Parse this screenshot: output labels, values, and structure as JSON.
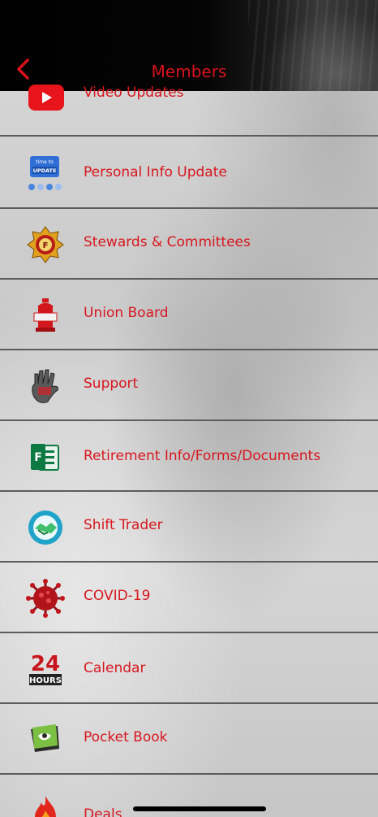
{
  "header": {
    "title": "Members",
    "back_icon": "chevron-left-icon"
  },
  "colors": {
    "accent": "#d8121b",
    "divider": "#5c5c5c",
    "header_bg": "#000000"
  },
  "menu": {
    "items": [
      {
        "label": "Video Updates",
        "icon": "youtube-icon"
      },
      {
        "label": "Personal Info Update",
        "icon": "time-to-update-icon"
      },
      {
        "label": "Stewards & Committees",
        "icon": "iaff-badge-icon"
      },
      {
        "label": "Union Board",
        "icon": "fire-hydrant-icon"
      },
      {
        "label": "Support",
        "icon": "hand-icon"
      },
      {
        "label": "Retirement Info/Forms/Documents",
        "icon": "forms-icon"
      },
      {
        "label": "Shift Trader",
        "icon": "handshake-icon"
      },
      {
        "label": "COVID-19",
        "icon": "virus-icon"
      },
      {
        "label": "Calendar",
        "icon": "24-hours-icon"
      },
      {
        "label": "Pocket Book",
        "icon": "pocket-book-icon"
      },
      {
        "label": "Deals",
        "icon": "flame-icon"
      }
    ]
  },
  "calendar_icon_text": {
    "big": "24",
    "small": "HOURS"
  },
  "update_icon_text": {
    "top": "time to",
    "bottom": "UPDATE"
  }
}
